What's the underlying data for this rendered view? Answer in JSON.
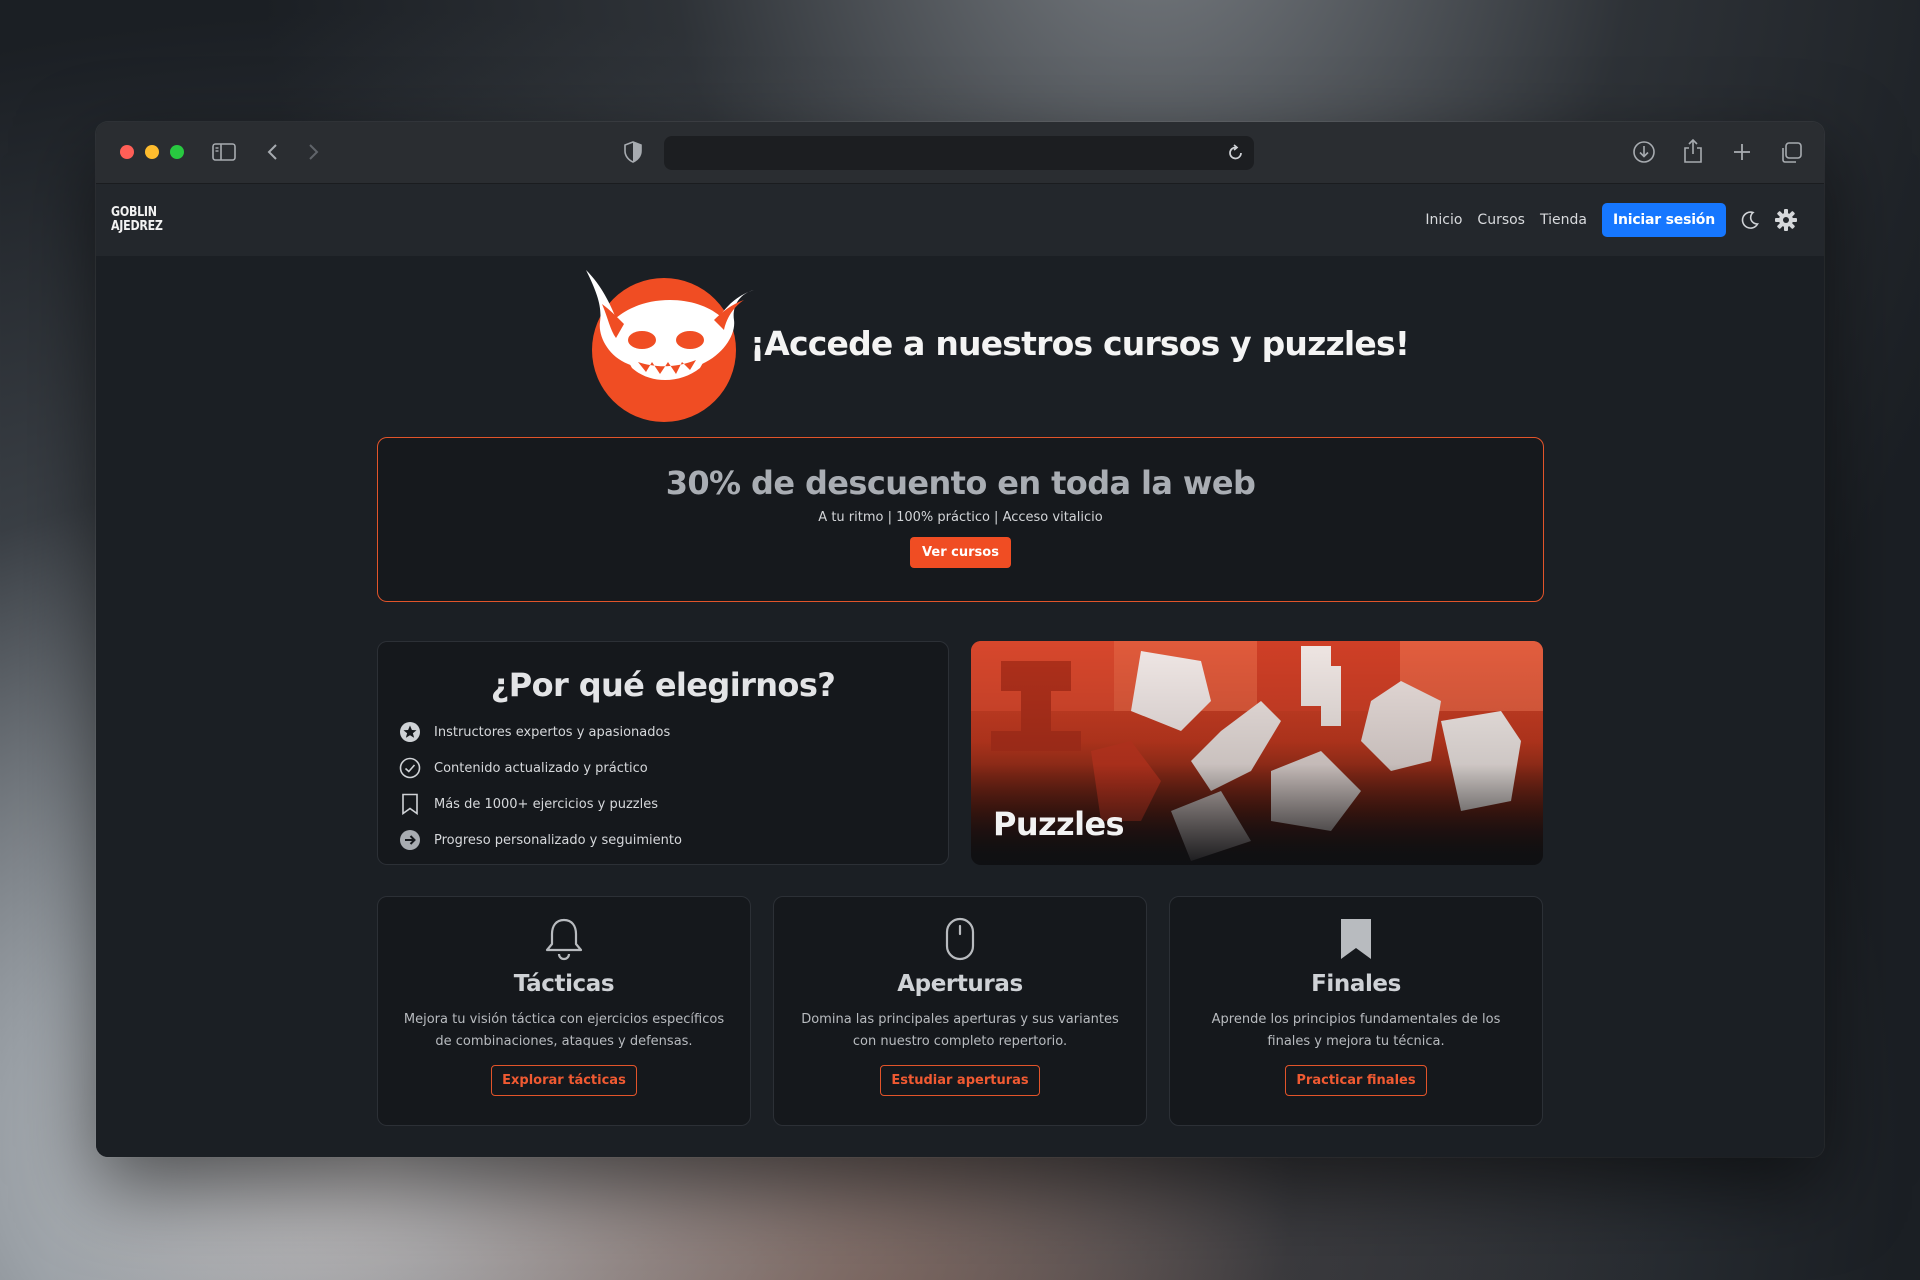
{
  "colors": {
    "accent": "#f04d23",
    "login_button": "#1677ff",
    "window_bg": "#1b1f24",
    "card_bg": "#15181c"
  },
  "browser": {
    "traffic_lights": [
      "#ff5f57",
      "#febc2e",
      "#28c840"
    ],
    "icons": [
      "sidebar-icon",
      "back-icon",
      "forward-icon",
      "shield-icon",
      "reload-icon",
      "download-icon",
      "share-icon",
      "new-tab-icon",
      "tabs-overview-icon"
    ]
  },
  "nav": {
    "logo_line1": "GOBLIN",
    "logo_line2": "AJEDREZ",
    "links": [
      "Inicio",
      "Cursos",
      "Tienda"
    ],
    "login": "Iniciar sesión",
    "icons": [
      "moon-icon",
      "gear-icon"
    ]
  },
  "hero": {
    "title": "¡Accede a nuestros cursos y puzzles!",
    "logo_icon": "goblin-logo-icon"
  },
  "promo": {
    "title": "30% de descuento en toda la web",
    "subtitle": "A tu ritmo | 100% práctico | Acceso vitalicio",
    "button": "Ver cursos"
  },
  "why": {
    "title": "¿Por qué elegirnos?",
    "items": [
      {
        "icon": "star-circle-icon",
        "text": "Instructores expertos y apasionados"
      },
      {
        "icon": "check-circle-icon",
        "text": "Contenido actualizado y práctico"
      },
      {
        "icon": "bookmark-icon",
        "text": "Más de 1000+ ejercicios y puzzles"
      },
      {
        "icon": "arrow-circle-icon",
        "text": "Progreso personalizado y seguimiento"
      }
    ]
  },
  "puzzles": {
    "label": "Puzzles"
  },
  "cards": [
    {
      "icon": "bell-icon",
      "title": "Tácticas",
      "desc": "Mejora tu visión táctica con ejercicios específicos de combinaciones, ataques y defensas.",
      "button": "Explorar tácticas"
    },
    {
      "icon": "mouse-icon",
      "title": "Aperturas",
      "desc": "Domina las principales aperturas y sus variantes con nuestro completo repertorio.",
      "button": "Estudiar aperturas"
    },
    {
      "icon": "bookmark-filled-icon",
      "title": "Finales",
      "desc": "Aprende los principios fundamentales de los finales y mejora tu técnica.",
      "button": "Practicar finales"
    }
  ]
}
